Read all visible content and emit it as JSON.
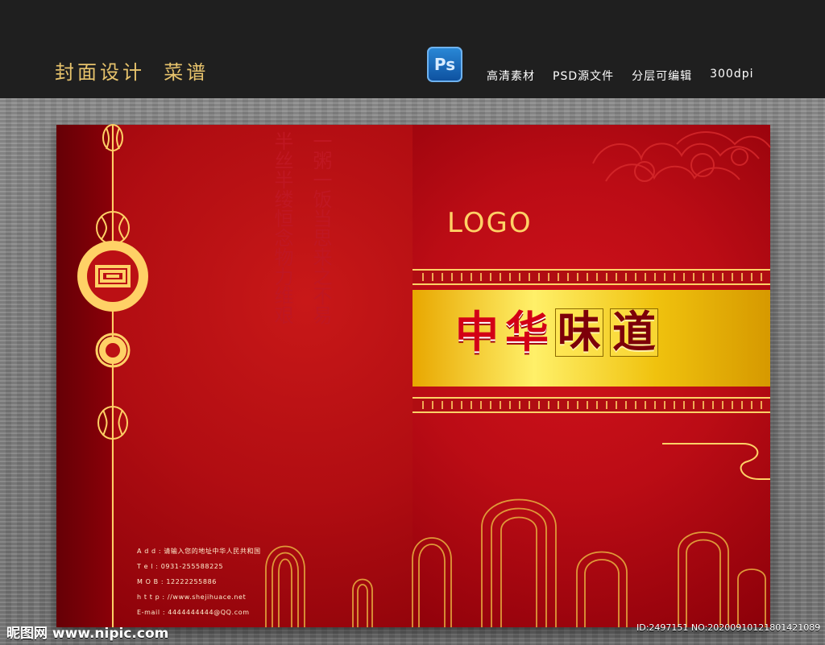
{
  "header": {
    "title": "封面设计  菜谱",
    "app_badge": "Ps",
    "features": [
      "高清素材",
      "PSD源文件",
      "分层可编辑",
      "300dpi"
    ]
  },
  "cover": {
    "logo": "LOGO",
    "title_chars": [
      "中",
      "华",
      "味",
      "道"
    ],
    "poem_lines": [
      "一粥一饭当思来之不易",
      "半丝半缕恒念物力维艰"
    ],
    "contact_lines": [
      "A d d : 请输入您的地址中华人民共和国",
      "T e l : 0931-255588225",
      "M O B : 12222255886",
      "h t t p : //www.shejihuace.net",
      "E-mail : 4444444444@QQ.com"
    ]
  },
  "watermark": {
    "left": "昵图网 www.nipic.com",
    "right": "ID:2497151 NO:20200910121801421089"
  },
  "colors": {
    "top_bar": "#1f1f1f",
    "gold": "#ffd166",
    "red": "#c00c16",
    "dark_red": "#7d0009"
  },
  "icons": [
    "photoshop-icon",
    "lantern-icon",
    "ornament-icon",
    "cloud-pattern-icon",
    "arch-pattern-icon"
  ]
}
